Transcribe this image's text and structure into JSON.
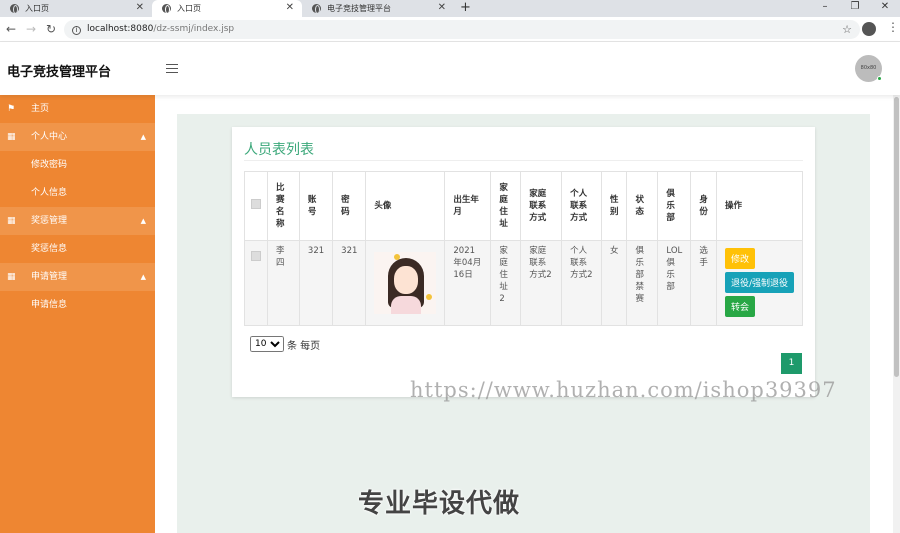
{
  "browser": {
    "tabs": [
      {
        "label": "入口页",
        "active": false
      },
      {
        "label": "入口页",
        "active": true
      },
      {
        "label": "电子竞技管理平台",
        "active": false
      }
    ],
    "url_host": "localhost:8080",
    "url_path": "/dz-ssmj/index.jsp"
  },
  "header": {
    "app_title": "电子竞技管理平台",
    "avatar_text": "80x80"
  },
  "sidebar": {
    "home": "主页",
    "groups": [
      {
        "label": "个人中心",
        "items": [
          "修改密码",
          "个人信息"
        ]
      },
      {
        "label": "奖惩管理",
        "items": [
          "奖惩信息"
        ]
      },
      {
        "label": "申请管理",
        "items": [
          "申请信息"
        ]
      }
    ]
  },
  "main": {
    "title": "人员表列表",
    "columns": [
      "比赛名称",
      "账号",
      "密码",
      "头像",
      "出生年月",
      "家庭住址",
      "家庭联系方式",
      "个人联系方式",
      "性别",
      "状态",
      "俱乐部",
      "身份",
      "操作"
    ],
    "rows": [
      {
        "name": "李四",
        "account": "321",
        "password": "321",
        "birth": "2021年04月16日",
        "address": "家庭住址2",
        "family_contact": "家庭联系方式2",
        "personal_contact": "个人联系方式2",
        "gender": "女",
        "status": "俱乐部禁赛",
        "club": "LOL俱乐部",
        "role": "选手",
        "actions": [
          "修改",
          "退役/强制退役",
          "转会"
        ]
      }
    ],
    "page_size": "10",
    "page_size_suffix": "条 每页",
    "current_page": "1"
  },
  "watermarks": {
    "url": "https://www.huzhan.com/ishop39397",
    "caption": "专业毕设代做"
  },
  "colors": {
    "sidebar": "#ee8632",
    "title_green": "#3ba87a",
    "btn_edit": "#ffc107",
    "btn_retire": "#17a2b8",
    "btn_transfer": "#28a745",
    "page_active": "#1e9a6b"
  }
}
